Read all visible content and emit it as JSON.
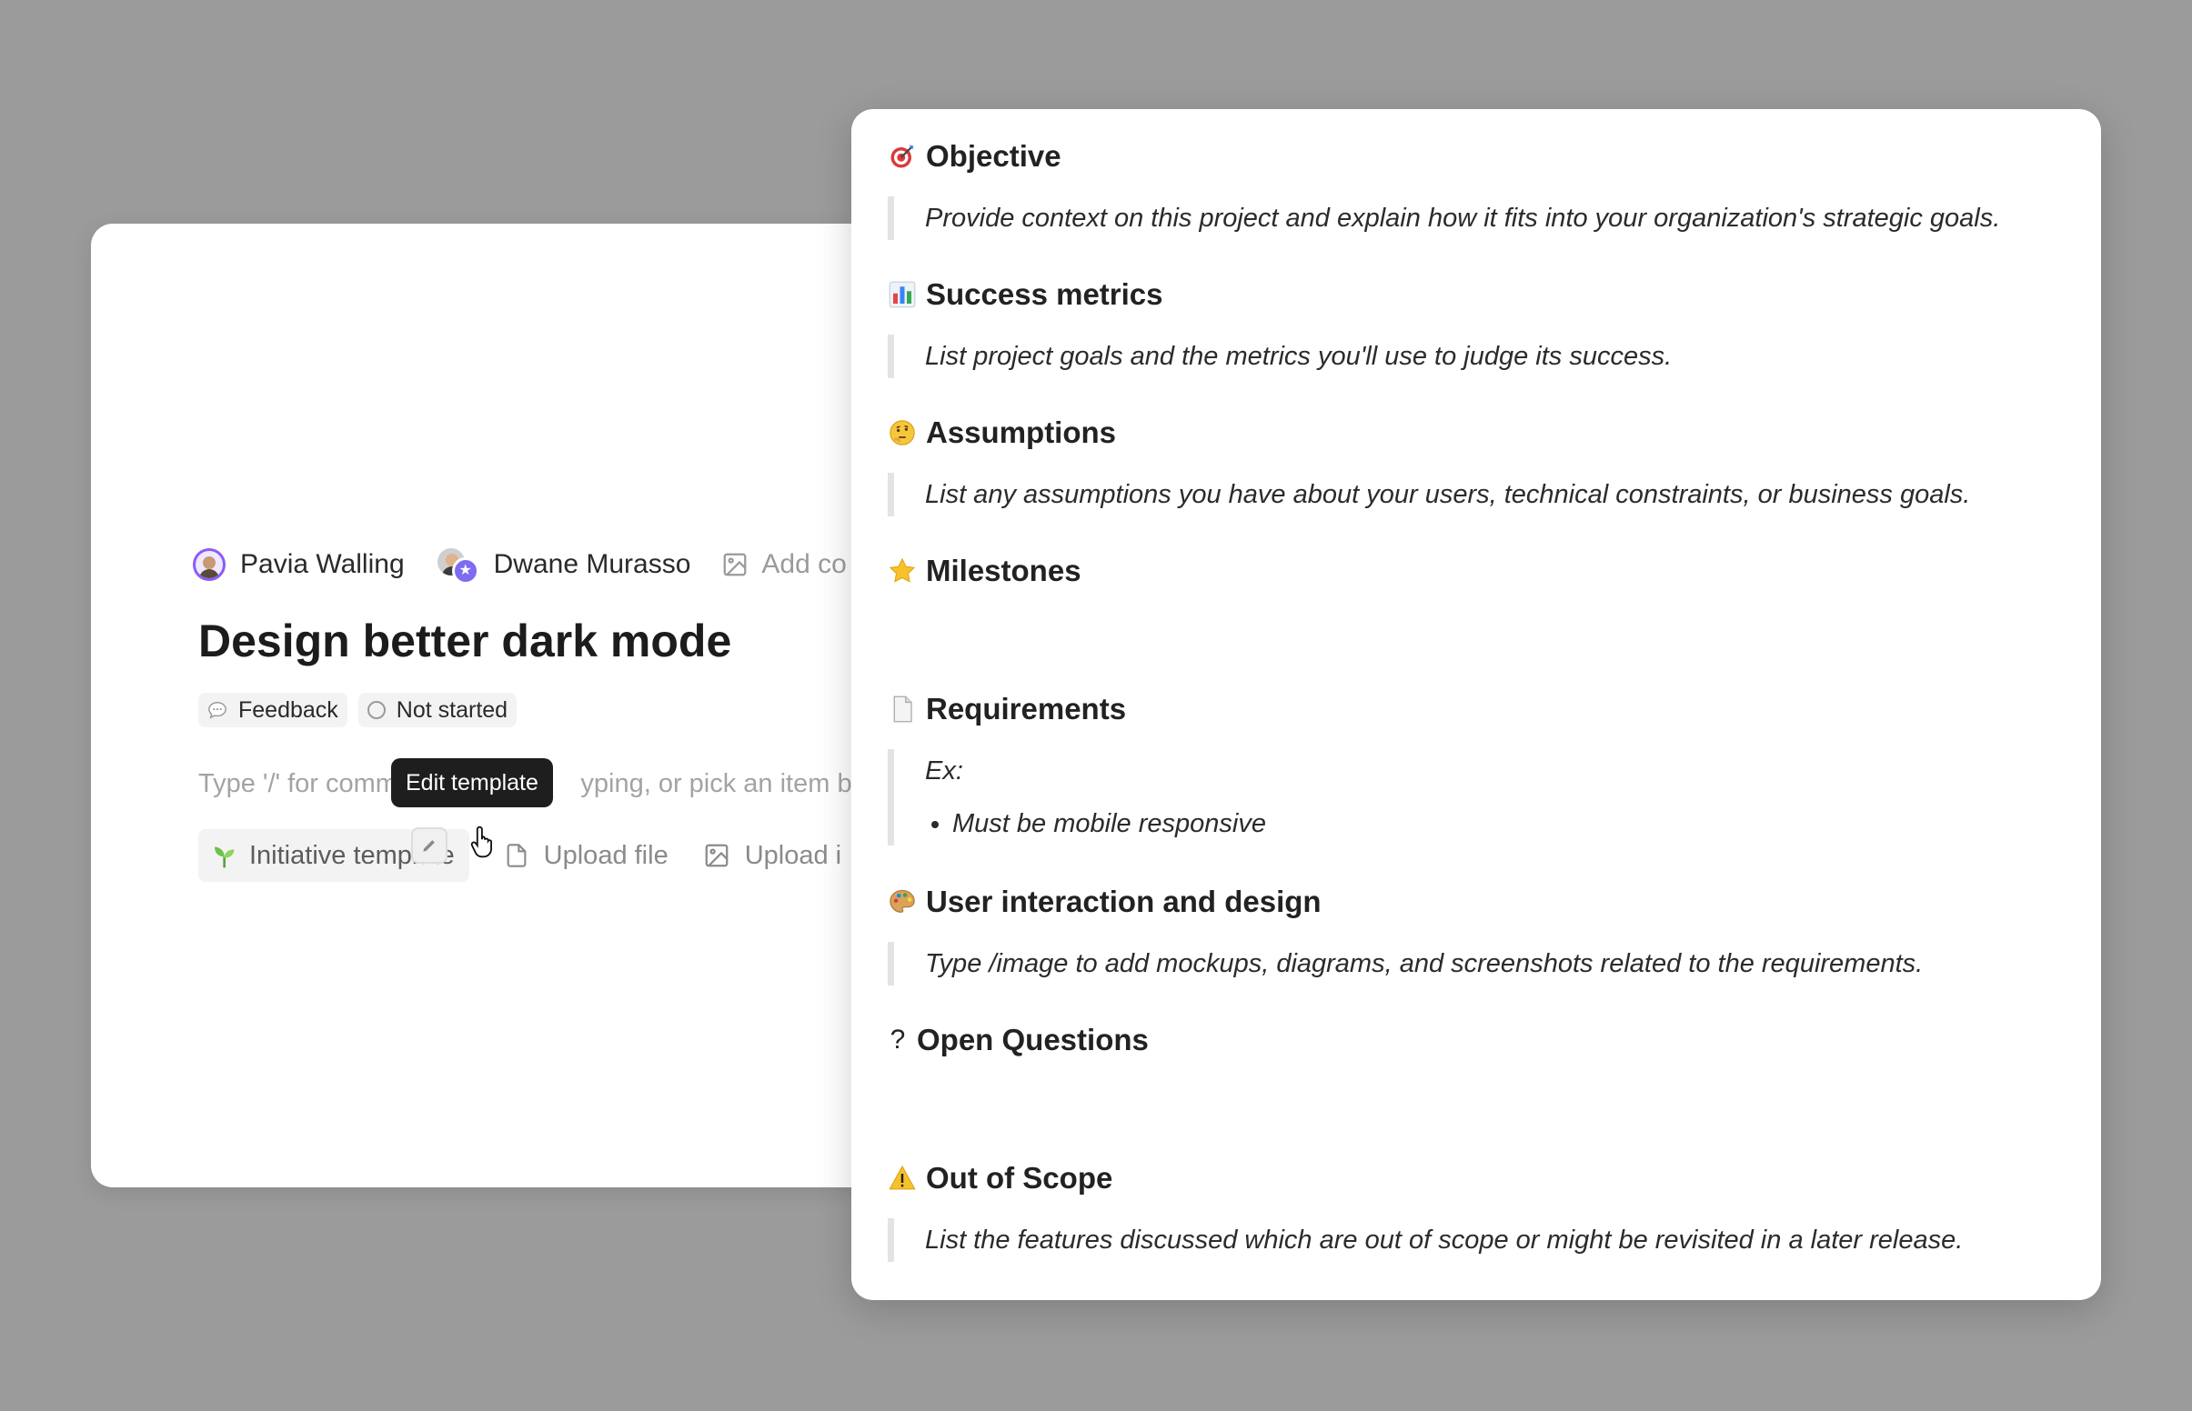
{
  "back": {
    "people": [
      {
        "name": "Pavia Walling"
      },
      {
        "name": "Dwane Murasso"
      }
    ],
    "add_cover": "Add co",
    "title": "Design better dark mode",
    "chips": [
      {
        "label": "Feedback",
        "icon": "speech-bubble-icon"
      },
      {
        "label": "Not started",
        "icon": "circle-status-icon"
      }
    ],
    "placeholder": "Type '/' for comm                         yping, or pick an item bel",
    "template_button": "Initiative template",
    "upload_file": "Upload file",
    "upload_image": "Upload i",
    "tooltip": "Edit template"
  },
  "template": {
    "sections": [
      {
        "heading": "Objective",
        "emoji": "target-icon",
        "body": "Provide context on this project and explain how it fits into your organization's strategic goals."
      },
      {
        "heading": "Success metrics",
        "emoji": "bar-chart-icon",
        "body": "List project goals and the metrics you'll use to judge its success."
      },
      {
        "heading": "Assumptions",
        "emoji": "thinking-face-icon",
        "body": "List any assumptions you have about your users, technical constraints, or business goals."
      },
      {
        "heading": "Milestones",
        "emoji": "star-icon",
        "body": ""
      },
      {
        "heading": "Requirements",
        "emoji": "page-icon",
        "body": "Ex:",
        "bullets": [
          "Must be mobile responsive"
        ]
      },
      {
        "heading": "User interaction and design",
        "emoji": "palette-icon",
        "body": "Type /image to add mockups, diagrams, and screenshots related to the requirements."
      },
      {
        "heading": "Open Questions",
        "emoji": "question-mark-icon",
        "emoji_text": "?",
        "body": ""
      },
      {
        "heading": "Out of Scope",
        "emoji": "warning-icon",
        "body": "List the features discussed which are out of scope or might be revisited in a later release."
      }
    ]
  },
  "colors": {
    "background": "#9b9b9b",
    "avatar_ring": "#8b5cf6",
    "sprout": "#6cc24a",
    "tooltip_bg": "#1e1e1e"
  }
}
